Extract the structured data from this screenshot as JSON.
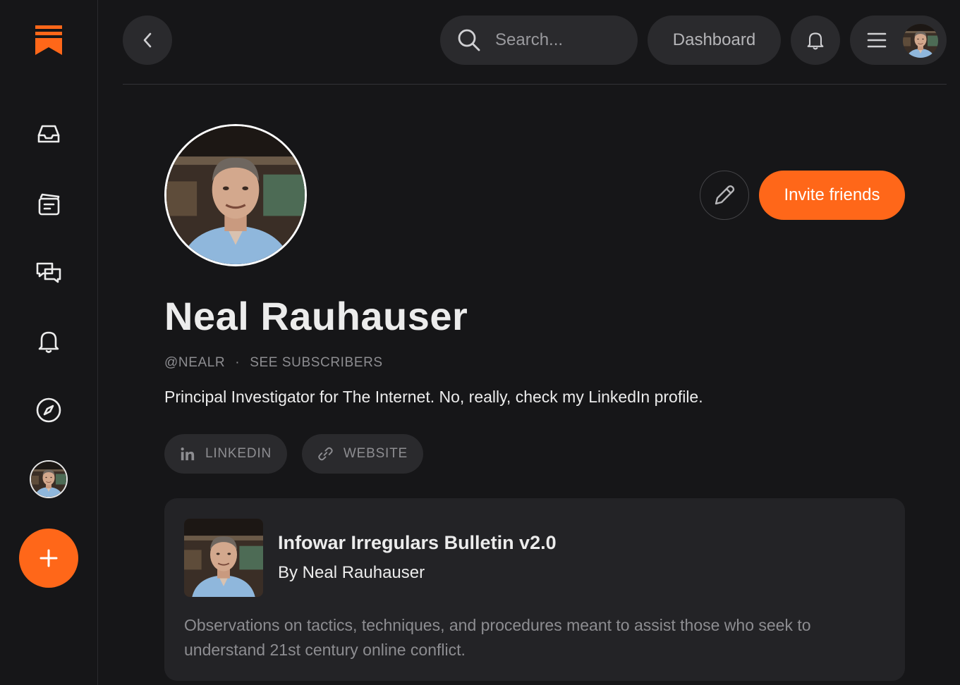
{
  "colors": {
    "accent": "#ff6719",
    "background": "#161618",
    "surface": "#2a2a2d",
    "card": "#232326",
    "muted_text": "#8d8d91"
  },
  "sidebar": {
    "logo_icon": "substack-logo-icon",
    "items": [
      {
        "icon": "inbox-icon"
      },
      {
        "icon": "posts-icon"
      },
      {
        "icon": "chat-icon"
      },
      {
        "icon": "bell-icon"
      },
      {
        "icon": "explore-compass-icon"
      },
      {
        "icon": "avatar"
      }
    ],
    "create_icon": "plus-icon"
  },
  "topbar": {
    "search_placeholder": "Search...",
    "dashboard_label": "Dashboard"
  },
  "profile": {
    "name": "Neal Rauhauser",
    "handle": "@NEALR",
    "separator": "·",
    "subscribers_link": "SEE SUBSCRIBERS",
    "bio": "Principal Investigator for The Internet. No, really, check my LinkedIn profile.",
    "invite_label": "Invite friends",
    "links": [
      {
        "label": "LINKEDIN",
        "icon": "linkedin-icon"
      },
      {
        "label": "WEBSITE",
        "icon": "link-icon"
      }
    ]
  },
  "publication": {
    "title": "Infowar Irregulars Bulletin v2.0",
    "author": "By Neal Rauhauser",
    "description": "Observations on tactics, techniques, and procedures meant to assist those who seek to understand 21st century online conflict."
  }
}
